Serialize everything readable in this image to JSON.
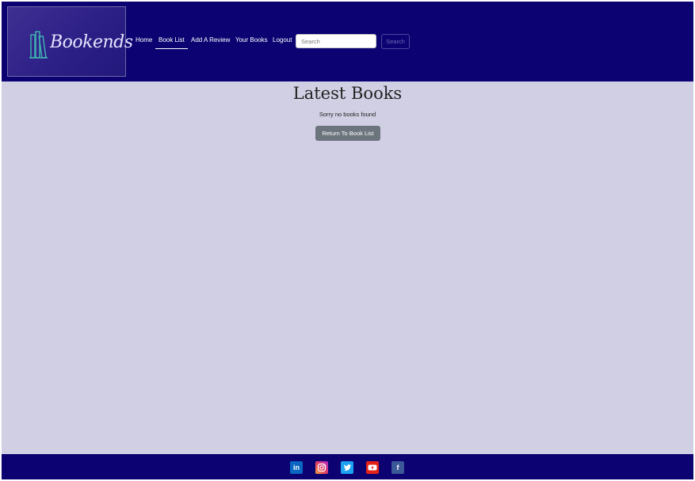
{
  "header": {
    "logo_text": "Bookends",
    "nav": [
      {
        "label": "Home"
      },
      {
        "label": "Book List"
      },
      {
        "label": "Add A Review"
      },
      {
        "label": "Your Books"
      },
      {
        "label": "Logout"
      }
    ],
    "search": {
      "placeholder": "Search",
      "button_label": "Search"
    }
  },
  "main": {
    "title": "Latest Books",
    "empty_message": "Sorry no books found",
    "return_button_label": "Return To Book List"
  },
  "footer": {
    "social_icons": [
      "linkedin-icon",
      "instagram-icon",
      "twitter-icon",
      "youtube-icon",
      "facebook-icon"
    ],
    "linkedin_text": "in",
    "facebook_text": "f"
  },
  "colors": {
    "header_bg": "#0c0272",
    "page_bg": "#d0cfe3",
    "button_gray": "#6c757d"
  }
}
